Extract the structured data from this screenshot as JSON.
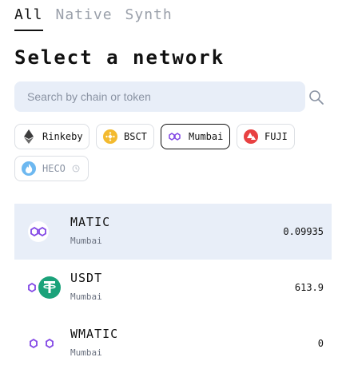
{
  "tabs": [
    {
      "label": "All",
      "active": true
    },
    {
      "label": "Native",
      "active": false
    },
    {
      "label": "Synth",
      "active": false
    }
  ],
  "title": "Select a network",
  "search": {
    "placeholder": "Search by chain or token",
    "value": ""
  },
  "networks": [
    {
      "label": "Rinkeby",
      "icon": "ethereum-icon",
      "selected": false
    },
    {
      "label": "BSCT",
      "icon": "binance-icon",
      "selected": false
    },
    {
      "label": "Mumbai",
      "icon": "polygon-icon",
      "selected": true
    },
    {
      "label": "FUJI",
      "icon": "avalanche-icon",
      "selected": false
    },
    {
      "label": "HECO",
      "icon": "heco-icon",
      "selected": false,
      "status_icon": "clock-icon"
    }
  ],
  "tokens": [
    {
      "symbol": "MATIC",
      "network": "Mumbai",
      "balance": "0.09935",
      "icon": "polygon-icon",
      "active": true
    },
    {
      "symbol": "USDT",
      "network": "Mumbai",
      "balance": "613.9",
      "icon": "tether-icon",
      "active": false
    },
    {
      "symbol": "WMATIC",
      "network": "Mumbai",
      "balance": "0",
      "icon": "polygon-icon",
      "active": false
    }
  ],
  "colors": {
    "accent": "#e8eef8",
    "polygon": "#8247e5",
    "tether": "#1ba27a",
    "binance": "#f3ba2f",
    "avalanche": "#e84142",
    "heco": "#6db8f0"
  }
}
